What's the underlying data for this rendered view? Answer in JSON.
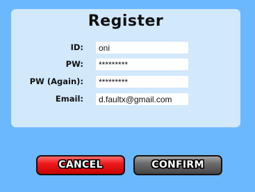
{
  "dialog": {
    "title": "Register"
  },
  "form": {
    "fields": [
      {
        "label": "ID:",
        "value": "oni",
        "type": "text"
      },
      {
        "label": "PW:",
        "value": "*********",
        "type": "password"
      },
      {
        "label": "PW (Again):",
        "value": "*********",
        "type": "password"
      },
      {
        "label": "Email:",
        "value": "d.faultx@gmail.com",
        "type": "text"
      }
    ]
  },
  "buttons": {
    "cancel_label": "CANCEL",
    "confirm_label": "CONFIRM"
  },
  "colors": {
    "background": "#6cb8ff",
    "panel": "#d2e8fb",
    "cancel": "#ee1c1c",
    "confirm": "#6c6c6c"
  }
}
